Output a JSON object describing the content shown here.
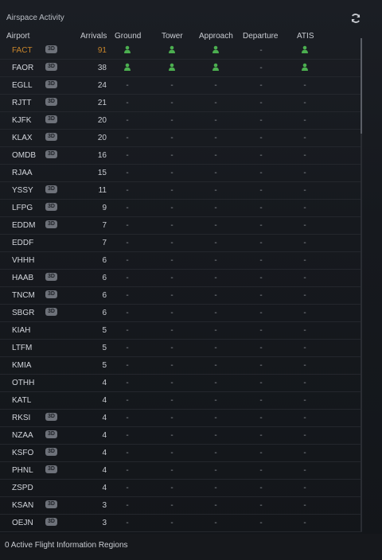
{
  "panel": {
    "title": "Airspace Activity"
  },
  "columns": {
    "airport": "Airport",
    "arrivals": "Arrivals",
    "ground": "Ground",
    "tower": "Tower",
    "approach": "Approach",
    "departure": "Departure",
    "atis": "ATIS"
  },
  "badge_label": "3D",
  "empty_value": "-",
  "colors": {
    "highlight": "#c8852a",
    "controller_online": "#4caf50"
  },
  "icons": {
    "refresh": "refresh-icon",
    "controller": "person-icon"
  },
  "rows": [
    {
      "airport": "FACT",
      "badge": true,
      "arrivals": "91",
      "highlight": true,
      "ground": true,
      "tower": true,
      "approach": true,
      "departure": false,
      "atis": true
    },
    {
      "airport": "FAOR",
      "badge": true,
      "arrivals": "38",
      "highlight": false,
      "ground": true,
      "tower": true,
      "approach": true,
      "departure": false,
      "atis": true
    },
    {
      "airport": "EGLL",
      "badge": true,
      "arrivals": "24",
      "highlight": false,
      "ground": false,
      "tower": false,
      "approach": false,
      "departure": false,
      "atis": false
    },
    {
      "airport": "RJTT",
      "badge": true,
      "arrivals": "21",
      "highlight": false,
      "ground": false,
      "tower": false,
      "approach": false,
      "departure": false,
      "atis": false
    },
    {
      "airport": "KJFK",
      "badge": true,
      "arrivals": "20",
      "highlight": false,
      "ground": false,
      "tower": false,
      "approach": false,
      "departure": false,
      "atis": false
    },
    {
      "airport": "KLAX",
      "badge": true,
      "arrivals": "20",
      "highlight": false,
      "ground": false,
      "tower": false,
      "approach": false,
      "departure": false,
      "atis": false
    },
    {
      "airport": "OMDB",
      "badge": true,
      "arrivals": "16",
      "highlight": false,
      "ground": false,
      "tower": false,
      "approach": false,
      "departure": false,
      "atis": false
    },
    {
      "airport": "RJAA",
      "badge": false,
      "arrivals": "15",
      "highlight": false,
      "ground": false,
      "tower": false,
      "approach": false,
      "departure": false,
      "atis": false
    },
    {
      "airport": "YSSY",
      "badge": true,
      "arrivals": "11",
      "highlight": false,
      "ground": false,
      "tower": false,
      "approach": false,
      "departure": false,
      "atis": false
    },
    {
      "airport": "LFPG",
      "badge": true,
      "arrivals": "9",
      "highlight": false,
      "ground": false,
      "tower": false,
      "approach": false,
      "departure": false,
      "atis": false
    },
    {
      "airport": "EDDM",
      "badge": true,
      "arrivals": "7",
      "highlight": false,
      "ground": false,
      "tower": false,
      "approach": false,
      "departure": false,
      "atis": false
    },
    {
      "airport": "EDDF",
      "badge": false,
      "arrivals": "7",
      "highlight": false,
      "ground": false,
      "tower": false,
      "approach": false,
      "departure": false,
      "atis": false
    },
    {
      "airport": "VHHH",
      "badge": false,
      "arrivals": "6",
      "highlight": false,
      "ground": false,
      "tower": false,
      "approach": false,
      "departure": false,
      "atis": false
    },
    {
      "airport": "HAAB",
      "badge": true,
      "arrivals": "6",
      "highlight": false,
      "ground": false,
      "tower": false,
      "approach": false,
      "departure": false,
      "atis": false
    },
    {
      "airport": "TNCM",
      "badge": true,
      "arrivals": "6",
      "highlight": false,
      "ground": false,
      "tower": false,
      "approach": false,
      "departure": false,
      "atis": false
    },
    {
      "airport": "SBGR",
      "badge": true,
      "arrivals": "6",
      "highlight": false,
      "ground": false,
      "tower": false,
      "approach": false,
      "departure": false,
      "atis": false
    },
    {
      "airport": "KIAH",
      "badge": false,
      "arrivals": "5",
      "highlight": false,
      "ground": false,
      "tower": false,
      "approach": false,
      "departure": false,
      "atis": false
    },
    {
      "airport": "LTFM",
      "badge": false,
      "arrivals": "5",
      "highlight": false,
      "ground": false,
      "tower": false,
      "approach": false,
      "departure": false,
      "atis": false
    },
    {
      "airport": "KMIA",
      "badge": false,
      "arrivals": "5",
      "highlight": false,
      "ground": false,
      "tower": false,
      "approach": false,
      "departure": false,
      "atis": false
    },
    {
      "airport": "OTHH",
      "badge": false,
      "arrivals": "4",
      "highlight": false,
      "ground": false,
      "tower": false,
      "approach": false,
      "departure": false,
      "atis": false
    },
    {
      "airport": "KATL",
      "badge": false,
      "arrivals": "4",
      "highlight": false,
      "ground": false,
      "tower": false,
      "approach": false,
      "departure": false,
      "atis": false
    },
    {
      "airport": "RKSI",
      "badge": true,
      "arrivals": "4",
      "highlight": false,
      "ground": false,
      "tower": false,
      "approach": false,
      "departure": false,
      "atis": false
    },
    {
      "airport": "NZAA",
      "badge": true,
      "arrivals": "4",
      "highlight": false,
      "ground": false,
      "tower": false,
      "approach": false,
      "departure": false,
      "atis": false
    },
    {
      "airport": "KSFO",
      "badge": true,
      "arrivals": "4",
      "highlight": false,
      "ground": false,
      "tower": false,
      "approach": false,
      "departure": false,
      "atis": false
    },
    {
      "airport": "PHNL",
      "badge": true,
      "arrivals": "4",
      "highlight": false,
      "ground": false,
      "tower": false,
      "approach": false,
      "departure": false,
      "atis": false
    },
    {
      "airport": "ZSPD",
      "badge": false,
      "arrivals": "4",
      "highlight": false,
      "ground": false,
      "tower": false,
      "approach": false,
      "departure": false,
      "atis": false
    },
    {
      "airport": "KSAN",
      "badge": true,
      "arrivals": "3",
      "highlight": false,
      "ground": false,
      "tower": false,
      "approach": false,
      "departure": false,
      "atis": false
    },
    {
      "airport": "OEJN",
      "badge": true,
      "arrivals": "3",
      "highlight": false,
      "ground": false,
      "tower": false,
      "approach": false,
      "departure": false,
      "atis": false
    }
  ],
  "footer": {
    "status_text": "0 Active Flight Information Regions"
  }
}
